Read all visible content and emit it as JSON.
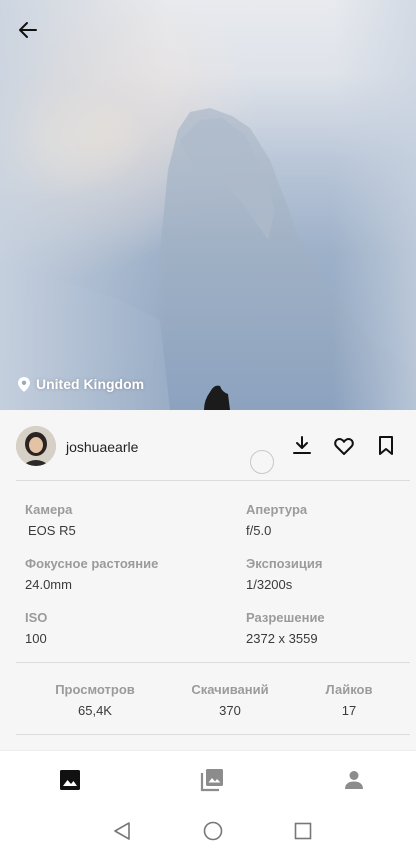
{
  "photo": {
    "location": "United Kingdom",
    "icons": {
      "back": "arrow-left-icon",
      "location": "location-pin-icon"
    }
  },
  "user": {
    "username": "joshuaearle",
    "icons": {
      "download": "download-icon",
      "like": "heart-icon",
      "save": "bookmark-icon"
    }
  },
  "exif": {
    "camera_label": "Камера",
    "camera_value": "EOS R5",
    "aperture_label": "Апертура",
    "aperture_value": "f/5.0",
    "focal_label": "Фокусное растояние",
    "focal_value": "24.0mm",
    "exposure_label": "Экспозиция",
    "exposure_value": "1/3200s",
    "iso_label": "ISO",
    "iso_value": "100",
    "resolution_label": "Разрешение",
    "resolution_value": "2372 x 3559"
  },
  "stats": {
    "views_label": "Просмотров",
    "views_value": "65,4K",
    "downloads_label": "Скачиваний",
    "downloads_value": "370",
    "likes_label": "Лайков",
    "likes_value": "17"
  },
  "bottom_nav": {
    "items": [
      "photo-icon",
      "collections-icon",
      "profile-icon"
    ],
    "active": "photo-icon"
  },
  "system_nav": [
    "back-triangle-icon",
    "home-circle-icon",
    "recents-square-icon"
  ]
}
